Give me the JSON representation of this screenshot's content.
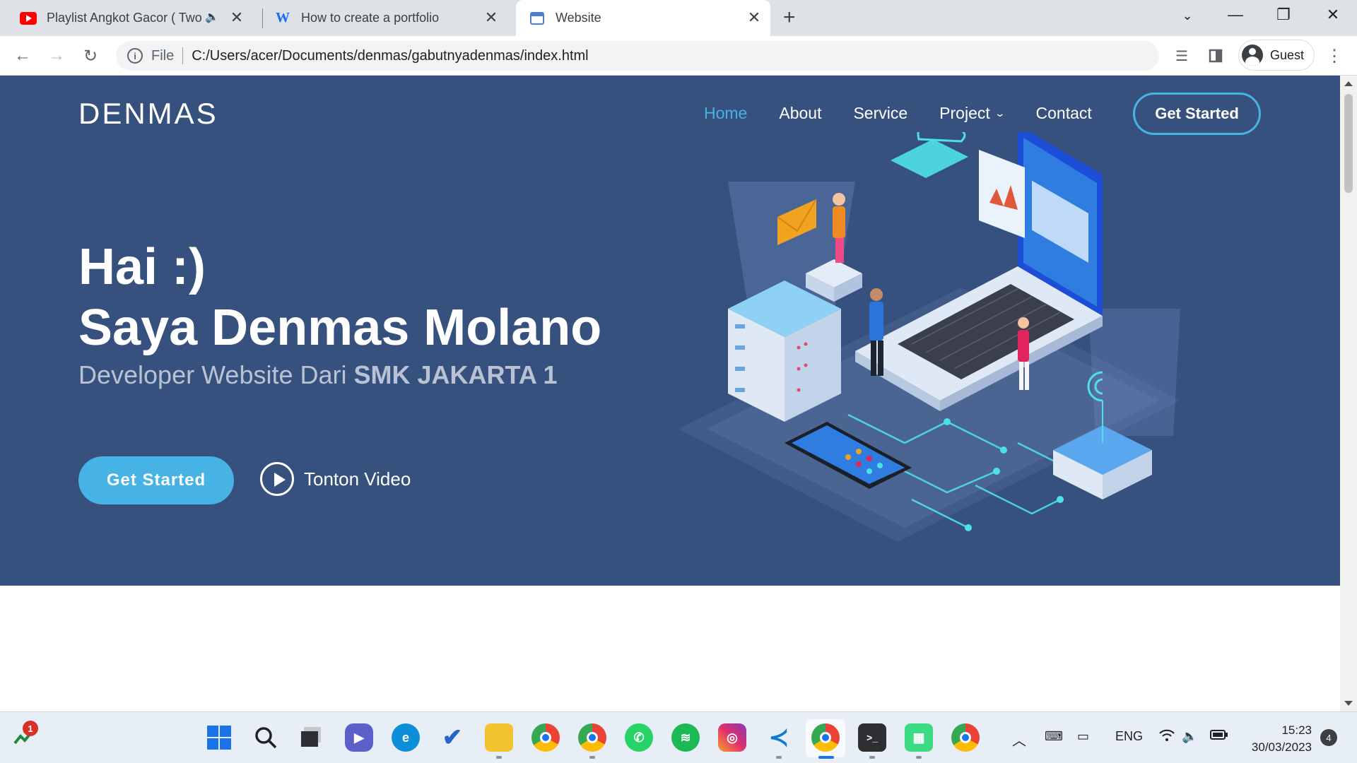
{
  "browser": {
    "tabs": [
      {
        "title": "Playlist Angkot Gacor ( Two V",
        "favicon": "youtube-icon",
        "audio": true
      },
      {
        "title": "How to create a portfolio",
        "favicon": "wix-icon"
      },
      {
        "title": "Website",
        "favicon": "page-icon",
        "active": true
      }
    ],
    "new_tab_symbol": "+",
    "address": {
      "scheme": "File",
      "url": "C:/Users/acer/Documents/denmas/gabutnyadenmas/index.html"
    },
    "profile_label": "Guest"
  },
  "site": {
    "logo": "DENMAS",
    "nav": [
      {
        "label": "Home",
        "active": true
      },
      {
        "label": "About"
      },
      {
        "label": "Service"
      },
      {
        "label": "Project",
        "dropdown": true
      },
      {
        "label": "Contact"
      }
    ],
    "nav_cta": "Get Started",
    "hero": {
      "line1": "Hai :)",
      "line2": "Saya Denmas Molano",
      "sub_prefix": "Developer Website Dari ",
      "sub_strong": "SMK JAKARTA 1",
      "cta": "Get Started",
      "watch": "Tonton Video"
    },
    "colors": {
      "hero_bg": "#37517e",
      "accent": "#47b2e4"
    }
  },
  "taskbar": {
    "notification_badge": "1",
    "apps": [
      "start-icon",
      "search-icon",
      "task-view-icon",
      "meet-icon",
      "edge-icon",
      "todo-icon",
      "file-explorer-icon",
      "chrome-icon",
      "chrome-profile-icon",
      "whatsapp-icon",
      "spotify-icon",
      "instagram-icon",
      "vscode-icon",
      "chrome-active-icon",
      "terminal-icon",
      "android-studio-icon",
      "chrome-icon-2"
    ],
    "language": "ENG",
    "time": "15:23",
    "date": "30/03/2023",
    "notifications_count": "4"
  }
}
